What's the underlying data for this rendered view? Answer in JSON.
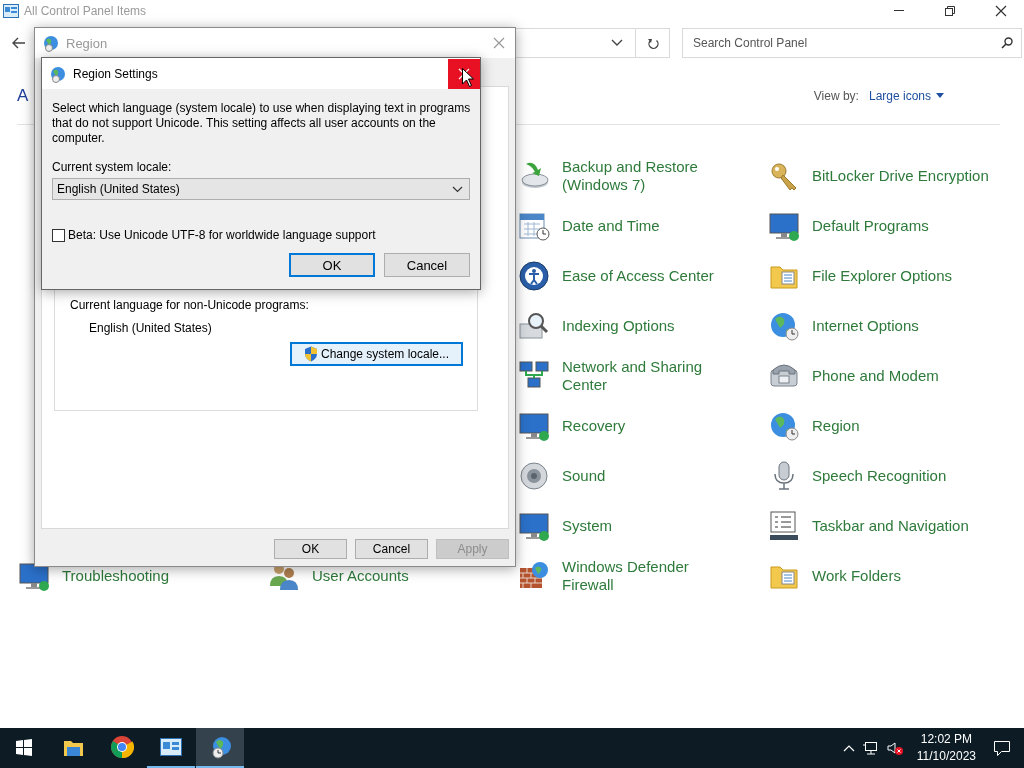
{
  "control_panel": {
    "title": "All Control Panel Items",
    "search": {
      "placeholder": "Search Control Panel"
    },
    "heading": "A",
    "view_by": {
      "label": "View by:",
      "value": "Large icons"
    },
    "items": [
      {
        "label": "Backup and Restore (Windows 7)"
      },
      {
        "label": "BitLocker Drive Encryption"
      },
      {
        "label": "Date and Time"
      },
      {
        "label": "Default Programs"
      },
      {
        "label": "Ease of Access Center"
      },
      {
        "label": "File Explorer Options"
      },
      {
        "label": "Indexing Options"
      },
      {
        "label": "Internet Options"
      },
      {
        "label": "Network and Sharing Center"
      },
      {
        "label": "Phone and Modem"
      },
      {
        "label": "Recovery"
      },
      {
        "label": "Region"
      },
      {
        "label": "Sound"
      },
      {
        "label": "Speech Recognition"
      },
      {
        "label": "System"
      },
      {
        "label": "Taskbar and Navigation"
      },
      {
        "label": "Troubleshooting"
      },
      {
        "label": "User Accounts"
      },
      {
        "label": "Windows Defender Firewall"
      },
      {
        "label": "Work Folders"
      }
    ]
  },
  "region_dialog": {
    "title": "Region",
    "active": false,
    "group_label": "Current language for non-Unicode programs:",
    "group_value": "English (United States)",
    "locale_button": {
      "label": "Change system locale...",
      "focused": true
    },
    "buttons": [
      {
        "label": "OK",
        "disabled": false
      },
      {
        "label": "Cancel",
        "disabled": false
      },
      {
        "label": "Apply",
        "disabled": true
      }
    ]
  },
  "settings_dialog": {
    "title": "Region Settings",
    "active": true,
    "close_hovered": true,
    "description": "Select which language (system locale) to use when displaying text in programs that do not support Unicode. This setting affects all user accounts on the computer.",
    "locale_label": "Current system locale:",
    "locale_value": "English (United States)",
    "utf8_checkbox": {
      "label": "Beta: Use Unicode UTF-8 for worldwide language support",
      "checked": false
    },
    "buttons": [
      {
        "label": "OK",
        "default": true
      },
      {
        "label": "Cancel",
        "default": false
      }
    ]
  },
  "taskbar": {
    "apps": [
      {
        "kind": "start",
        "running": false,
        "active": false
      },
      {
        "kind": "explorer",
        "running": false,
        "active": false
      },
      {
        "kind": "chrome",
        "running": false,
        "active": false
      },
      {
        "kind": "control-panel",
        "running": true,
        "active": false
      },
      {
        "kind": "region",
        "running": true,
        "active": true
      }
    ],
    "clock": {
      "time": "12:02 PM",
      "date": "11/10/2023"
    }
  }
}
